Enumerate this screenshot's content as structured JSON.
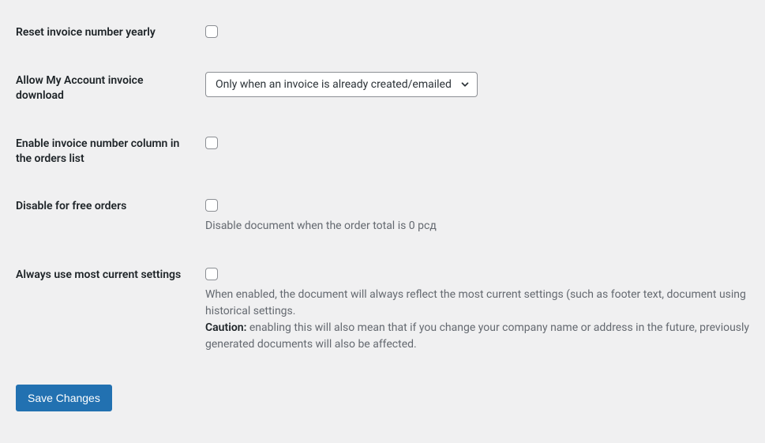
{
  "settings": {
    "reset_yearly": {
      "label": "Reset invoice number yearly"
    },
    "allow_download": {
      "label": "Allow My Account invoice download",
      "selected": "Only when an invoice is already created/emailed"
    },
    "enable_column": {
      "label": "Enable invoice number column in the orders list"
    },
    "disable_free": {
      "label": "Disable for free orders",
      "description": "Disable document when the order total is 0 рсд"
    },
    "always_current": {
      "label": "Always use most current settings",
      "description_line1": "When enabled, the document will always reflect the most current settings (such as footer text, document using historical settings.",
      "caution_label": "Caution:",
      "caution_text": " enabling this will also mean that if you change your company name or address in the future, previously generated documents will also be affected."
    }
  },
  "actions": {
    "save_label": "Save Changes"
  }
}
